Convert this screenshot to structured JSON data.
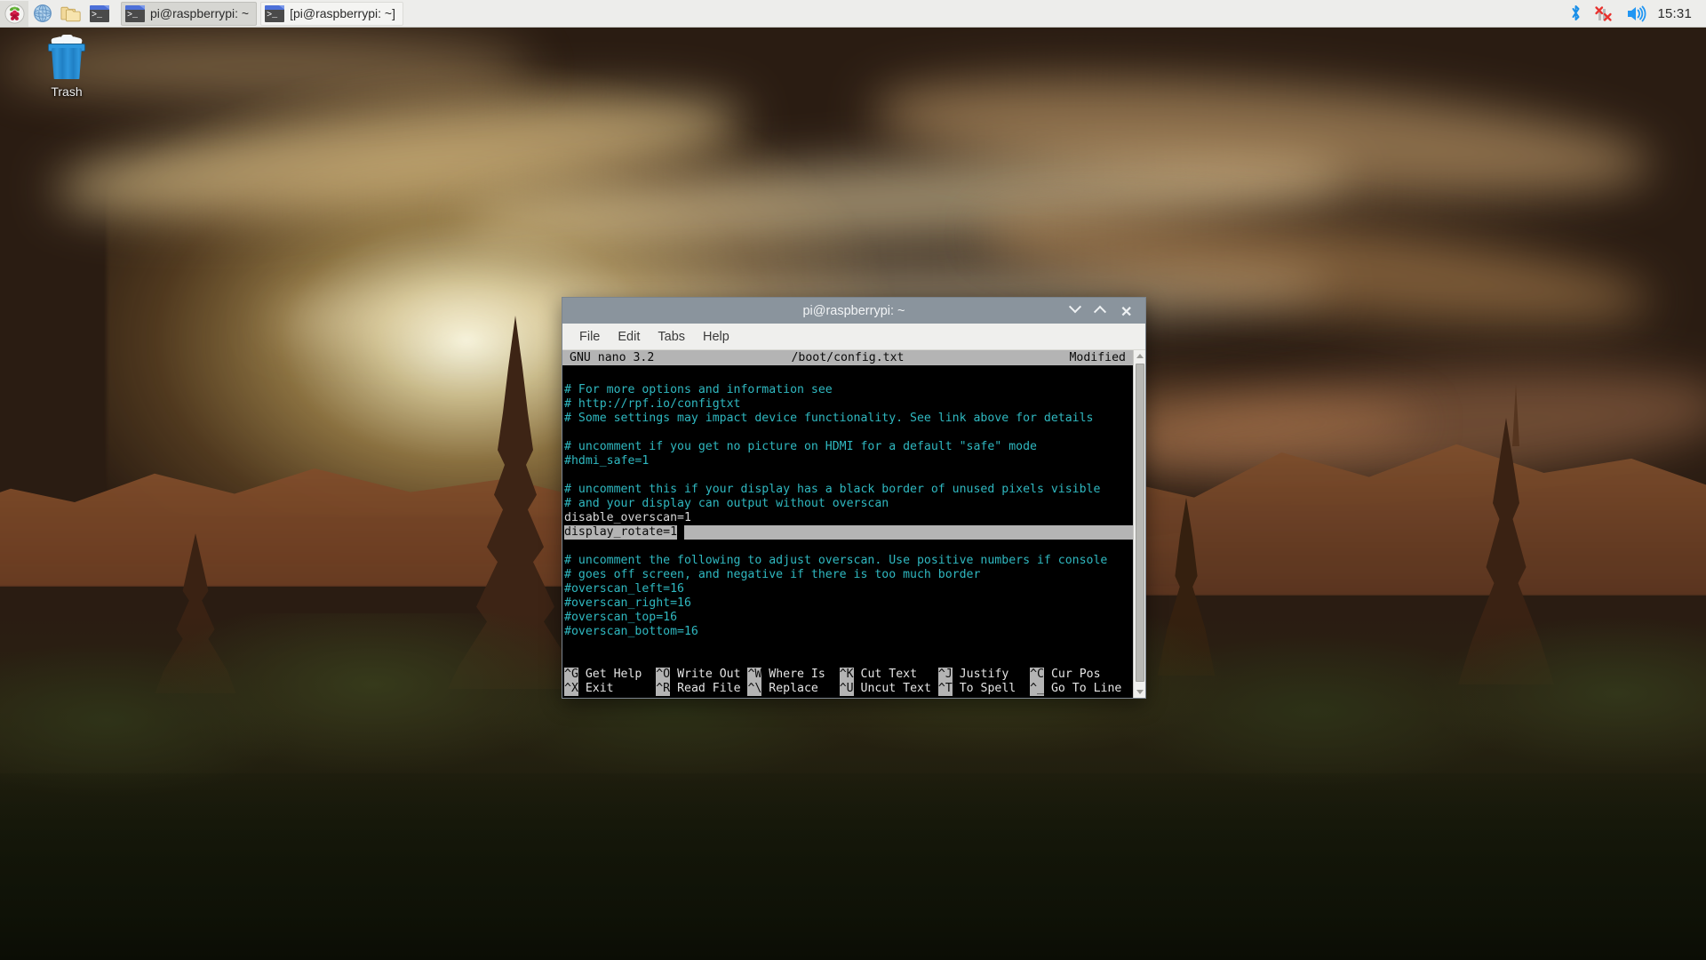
{
  "taskbar": {
    "launchers": [
      {
        "name": "raspberry-menu",
        "icon": "raspberry-icon",
        "tooltip": "Menu"
      },
      {
        "name": "web-browser",
        "icon": "globe-icon",
        "tooltip": "Web Browser"
      },
      {
        "name": "file-manager",
        "icon": "folder-icon",
        "tooltip": "File Manager"
      },
      {
        "name": "terminal",
        "icon": "terminal-icon",
        "tooltip": "Terminal"
      }
    ],
    "windows": [
      {
        "label": "pi@raspberrypi: ~",
        "active": true
      },
      {
        "label": "[pi@raspberrypi: ~]",
        "active": false
      }
    ],
    "tray": {
      "bluetooth": "bluetooth-icon",
      "network": "network-disconnected-icon",
      "volume": "volume-icon",
      "clock": "15:31"
    }
  },
  "desktop": {
    "icons": [
      {
        "label": "Trash",
        "icon": "trash-icon"
      }
    ]
  },
  "window": {
    "title": "pi@raspberrypi: ~",
    "controls": {
      "minimize": "minimize-icon",
      "maximize": "maximize-icon",
      "close": "close-icon"
    },
    "menu": [
      "File",
      "Edit",
      "Tabs",
      "Help"
    ]
  },
  "nano": {
    "header": {
      "version": "GNU nano 3.2",
      "filename": "/boot/config.txt",
      "status": "Modified"
    },
    "lines": [
      {
        "text": "",
        "style": "blank"
      },
      {
        "text": "# For more options and information see",
        "style": "comment"
      },
      {
        "text": "# http://rpf.io/configtxt",
        "style": "comment"
      },
      {
        "text": "# Some settings may impact device functionality. See link above for details",
        "style": "comment"
      },
      {
        "text": "",
        "style": "blank"
      },
      {
        "text": "# uncomment if you get no picture on HDMI for a default \"safe\" mode",
        "style": "comment"
      },
      {
        "text": "#hdmi_safe=1",
        "style": "comment"
      },
      {
        "text": "",
        "style": "blank"
      },
      {
        "text": "# uncomment this if your display has a black border of unused pixels visible",
        "style": "comment"
      },
      {
        "text": "# and your display can output without overscan",
        "style": "comment"
      },
      {
        "text": "disable_overscan=1",
        "style": "plain"
      },
      {
        "text": "display_rotate=1",
        "style": "selected"
      },
      {
        "text": "",
        "style": "blank"
      },
      {
        "text": "# uncomment the following to adjust overscan. Use positive numbers if console",
        "style": "comment"
      },
      {
        "text": "# goes off screen, and negative if there is too much border",
        "style": "comment"
      },
      {
        "text": "#overscan_left=16",
        "style": "comment"
      },
      {
        "text": "#overscan_right=16",
        "style": "comment"
      },
      {
        "text": "#overscan_top=16",
        "style": "comment"
      },
      {
        "text": "#overscan_bottom=16",
        "style": "comment"
      }
    ],
    "shortcuts_row1": [
      {
        "key": "^G",
        "label": " Get Help"
      },
      {
        "key": "^O",
        "label": " Write Out"
      },
      {
        "key": "^W",
        "label": " Where Is"
      },
      {
        "key": "^K",
        "label": " Cut Text"
      },
      {
        "key": "^J",
        "label": " Justify"
      },
      {
        "key": "^C",
        "label": " Cur Pos"
      }
    ],
    "shortcuts_row2": [
      {
        "key": "^X",
        "label": " Exit"
      },
      {
        "key": "^R",
        "label": " Read File"
      },
      {
        "key": "^\\",
        "label": " Replace"
      },
      {
        "key": "^U",
        "label": " Uncut Text"
      },
      {
        "key": "^T",
        "label": " To Spell"
      },
      {
        "key": "^_",
        "label": " Go To Line"
      }
    ]
  },
  "colors": {
    "taskbar_bg": "#ededeb",
    "titlebar_bg": "#8a949d",
    "menubar_bg": "#efefed",
    "terminal_bg": "#000000",
    "comment_fg": "#2fb8c0",
    "plain_fg": "#d8d8d8",
    "nano_bar_bg": "#b4b4b4"
  }
}
